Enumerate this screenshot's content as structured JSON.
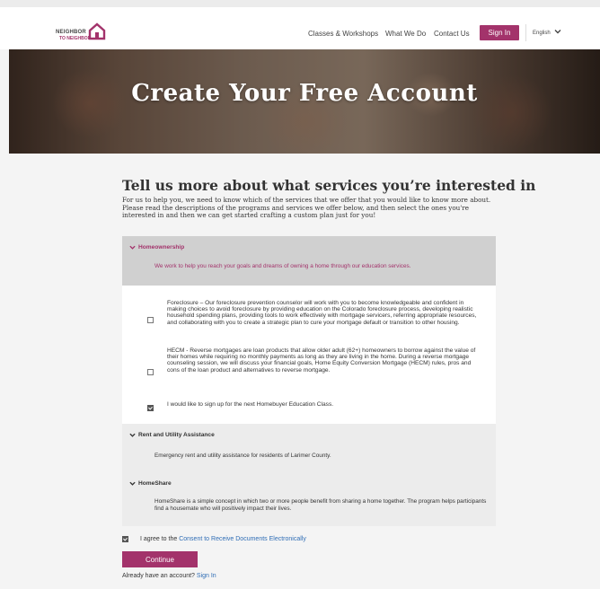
{
  "colors": {
    "brand": "#a3336b",
    "link": "#2f6db5",
    "section_header_bg": "#d0d0d0",
    "section_bg": "#ececec"
  },
  "header": {
    "logo_line1": "NEIGHBOR",
    "logo_line2": "TO NEIGHBOR",
    "nav": {
      "classes": "Classes & Workshops",
      "what_we_do": "What We Do",
      "contact": "Contact Us"
    },
    "signin_label": "Sign In",
    "language": "English",
    "language_icon": "chevron-down-icon"
  },
  "hero": {
    "title": "Create Your Free Account"
  },
  "form": {
    "title": "Tell us more about what services you’re interested in",
    "intro": "For us to help you, we need to know which of the services that we offer that you would like to know more about. Please read the descriptions of the programs and services we offer below, and then select the ones you're interested in and then we can get started crafting a custom plan just for you!",
    "sections": {
      "homeownership": {
        "title": "Homeownership",
        "description": "We work to help you reach your goals and dreams of owning a home through our education services.",
        "options": [
          {
            "text": "Foreclosure – Our foreclosure prevention counselor will work with you to become knowledgeable and confident in making choices to avoid foreclosure by providing education on the Colorado foreclosure process, developing realistic household spending plans, providing tools to work effectively with mortgage servicers, referring appropriate resources, and collaborating with you to create a strategic plan to cure your mortgage default or transition to other housing.",
            "checked": false
          },
          {
            "text": "HECM - Reverse mortgages are loan products that allow older adult (62+) homeowners to borrow against the value of their homes while requiring no monthly payments as long as they are living in the home.  During a reverse mortgage counseling session, we will discuss your financial goals, Home Equity Conversion Mortgage (HECM) rules, pros and cons of the loan product and alternatives to reverse mortgage.",
            "checked": false
          },
          {
            "text": "I would like to sign up for the next Homebuyer Education Class.",
            "checked": true
          }
        ]
      },
      "rent": {
        "title": "Rent and Utility Assistance",
        "description": "Emergency rent and utility assistance for residents of Larimer County."
      },
      "homeshare": {
        "title": "HomeShare",
        "description": "HomeShare is a simple concept in which two or more people benefit from sharing a home together. The program helps participants find a housemate who will positively impact their lives."
      }
    },
    "agree_prefix": "I agree to the",
    "agree_link": "Consent to Receive Documents Electronically",
    "agree_checked": true,
    "continue_label": "Continue",
    "already_text": "Already have an account?",
    "already_link": "Sign In"
  }
}
